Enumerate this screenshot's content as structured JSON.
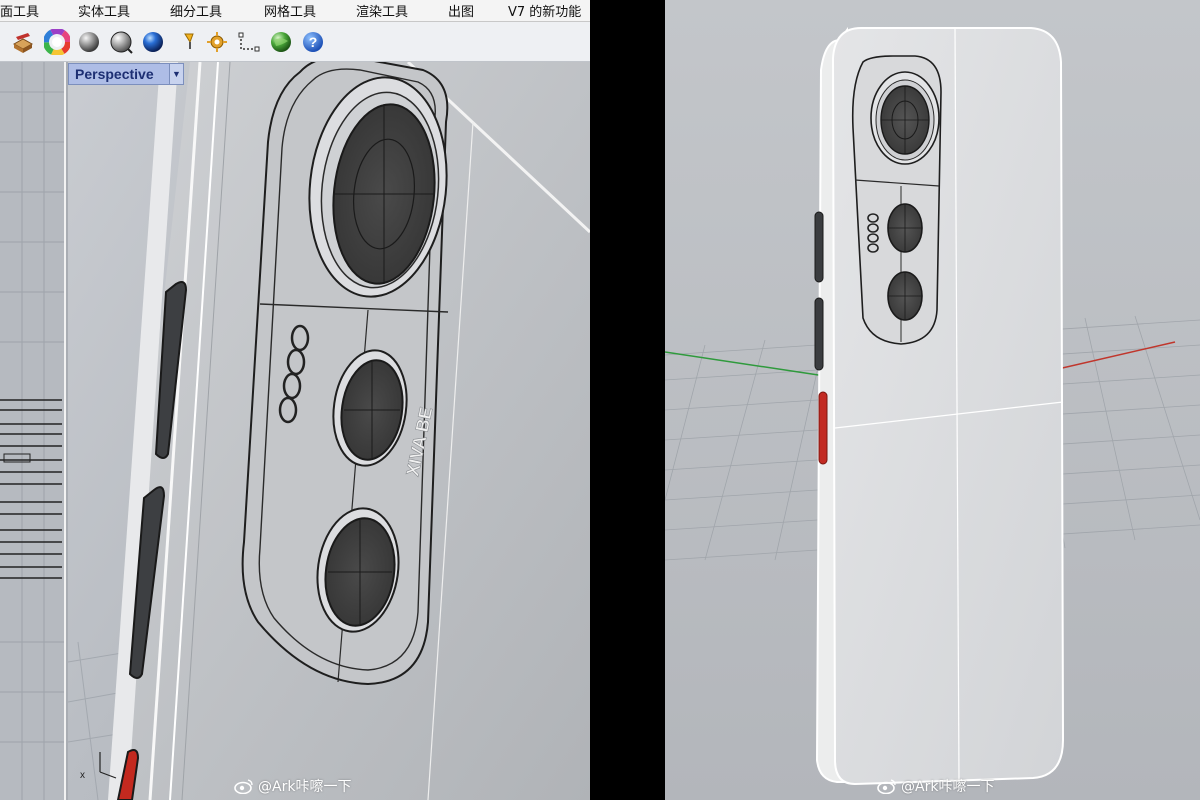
{
  "menubar": {
    "items": [
      "面工具",
      "实体工具",
      "细分工具",
      "网格工具",
      "渲染工具",
      "出图",
      "V7 的新功能"
    ]
  },
  "toolbar": {
    "icons": [
      "box-edit-icon",
      "color-wheel-icon",
      "sphere-icon",
      "sphere-outline-icon",
      "blue-sphere-icon",
      "light-icon",
      "gear-dots-icon",
      "snap-icon",
      "globe-icon",
      "help-icon"
    ]
  },
  "viewport": {
    "label": "Perspective",
    "dropdown_icon": "chevron-down-icon"
  },
  "phone": {
    "logo": "oooo",
    "lens_text": "XIVA BE"
  },
  "watermark": {
    "icon": "weibo-icon",
    "left_text": "@Ark咔嚓一下",
    "right_text": "@Ark咔嚓一下"
  },
  "colors": {
    "viewport_tab": "#aebde6",
    "accent_red": "#c22a22",
    "grid_x_axis": "#c0362c",
    "grid_y_axis": "#2f9a3c"
  }
}
